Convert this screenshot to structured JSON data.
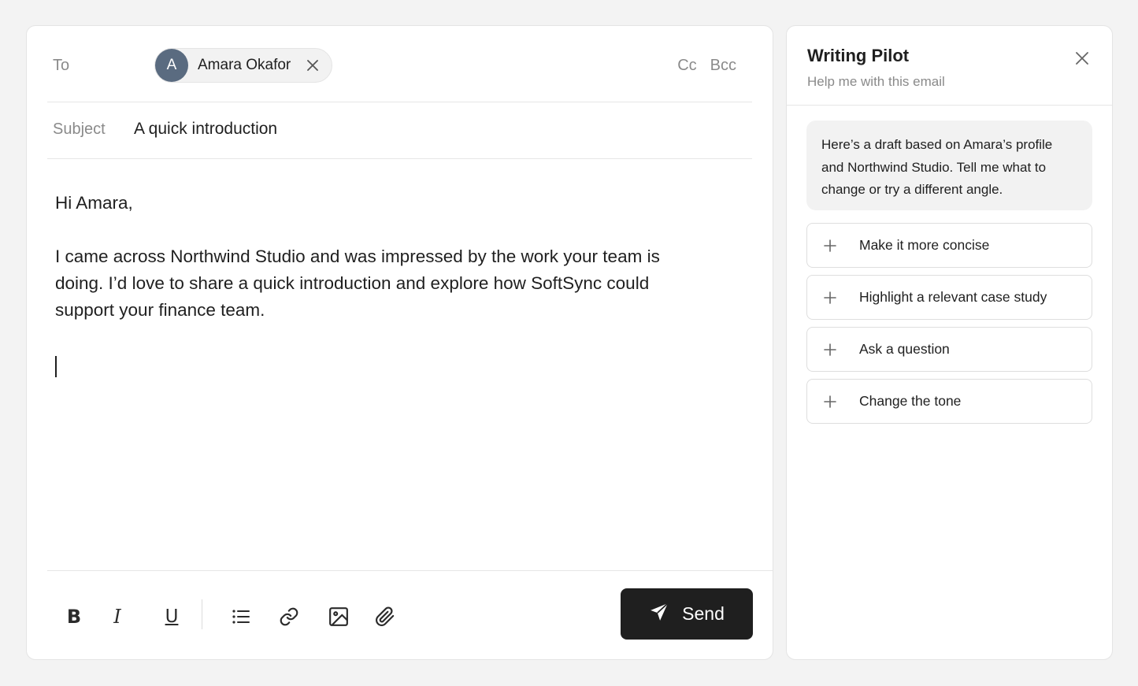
{
  "compose": {
    "to_label": "To",
    "recipient": {
      "initial": "A",
      "name": "Amara Okafor"
    },
    "cc_label": "Cc",
    "bcc_label": "Bcc",
    "subject_label": "Subject",
    "subject_value": "A quick introduction",
    "body": {
      "greeting": "Hi Amara,",
      "paragraph": "I came across Northwind Studio and was impressed by the work your team is doing. I’d love to share a quick introduction and explore how SoftSync could support your finance team."
    },
    "toolbar": {
      "bold": "B",
      "italic": "I",
      "underline": "U",
      "icons": [
        "bullet-list-icon",
        "link-icon",
        "image-icon",
        "paperclip-icon"
      ]
    },
    "send_label": "Send"
  },
  "pilot": {
    "title": "Writing Pilot",
    "subtitle": "Help me with this email",
    "message": "Here’s a draft based on Amara’s profile and Northwind Studio. Tell me what to change or try a different angle.",
    "suggestions": [
      "Make it more concise",
      "Highlight a relevant case study",
      "Ask a question",
      "Change the tone"
    ]
  },
  "colors": {
    "avatar": "#5a6b80",
    "send_button": "#1f1f1f",
    "muted_text": "#8a8a8a",
    "bubble": "#f2f2f2"
  }
}
